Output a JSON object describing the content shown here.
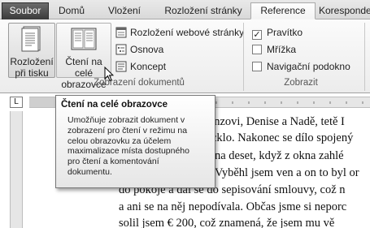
{
  "tabs": {
    "file": "Soubor",
    "home": "Domů",
    "insert": "Vložení",
    "layout": "Rozložení stránky",
    "references": "Reference",
    "mailings": "Korespondence"
  },
  "views_group": {
    "label": "Zobrazení dokumentů",
    "print_layout": [
      "Rozložení",
      "při tisku"
    ],
    "full_screen_reading": [
      "Čtení na celé",
      "obrazovce"
    ],
    "web_layout": "Rozložení webové stránky",
    "outline": "Osnova",
    "draft": "Koncept"
  },
  "show_group": {
    "label": "Zobrazit",
    "ruler": {
      "label": "Pravítko",
      "checked": true
    },
    "gridlines": {
      "label": "Mřížka",
      "checked": false
    },
    "navigation_pane": {
      "label": "Navigační podokno",
      "checked": false
    }
  },
  "ruler_corner": "L",
  "tooltip": {
    "title": "Čtení na celé obrazovce",
    "lines": [
      "Umožňuje zobrazit dokument v",
      "zobrazení pro čtení v režimu na",
      "celou obrazovku za účelem",
      "maximalizace místa dostupného",
      "pro čtení a komentování",
      "dokumentu."
    ]
  },
  "document": {
    "lines": [
      "onzovi, Denise a Nadě, tetě I",
      "cklo. Nakonec se dílo spojený",
      "na deset, když z okna zahlé",
      "Vyběhl jsem ven a on to byl or",
      "do pokoje a dal se do sepisování smlouvy, což n",
      "a ani se na něj nepodívala. Občas jsme si neporc",
      "solil jsem € 200, což znamená, že jsem mu vě"
    ]
  }
}
